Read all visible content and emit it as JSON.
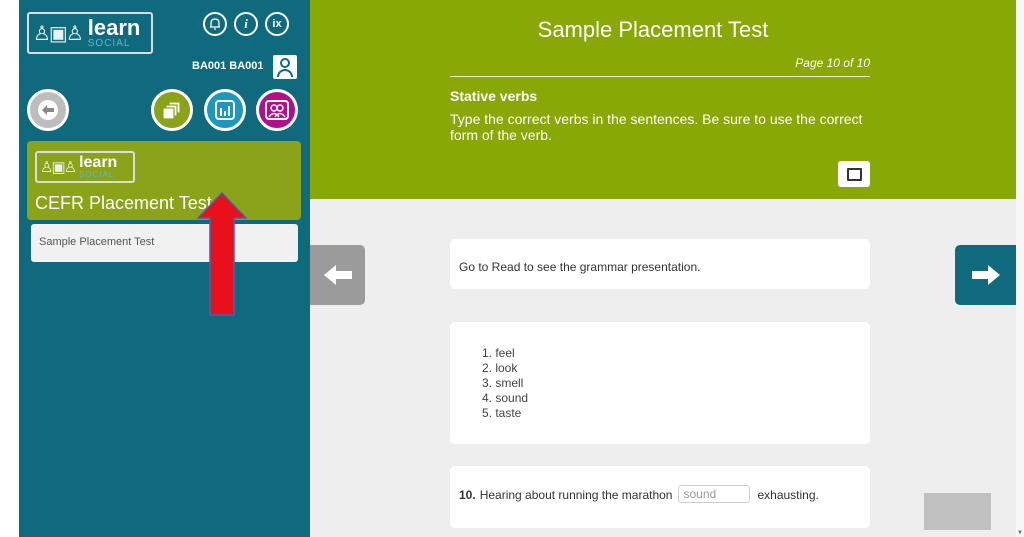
{
  "sidebar": {
    "logo": {
      "marks": "♙▣♙",
      "learn": "learn",
      "social": "SOCIAL"
    },
    "top_icons": [
      {
        "name": "bell-icon",
        "glyph": "♫"
      },
      {
        "name": "info-icon",
        "glyph": "i"
      },
      {
        "name": "accessibility-info-icon",
        "glyph": "ix"
      }
    ],
    "user_id": "BA001 BA001",
    "nav_buttons": {
      "back_glyph": "⬅",
      "courses_glyph": "❐",
      "stats_glyph": "ılı",
      "groups_glyph": "♙♙"
    },
    "course_card": {
      "logo": {
        "marks": "♙▣♙",
        "learn": "learn",
        "social": "SOCIAL"
      },
      "title": "CEFR Placement Test"
    },
    "items": [
      {
        "label": "Sample Placement Test"
      }
    ]
  },
  "header": {
    "title": "Sample Placement Test",
    "page_indicator": "Page 10 of 10",
    "section_title": "Stative verbs",
    "instructions": "Type the correct verbs in the sentences. Be sure to use the correct form of the verb."
  },
  "content": {
    "info_text": "Go to Read to see the grammar presentation.",
    "verb_list": [
      "1. feel",
      "2. look",
      "3. smell",
      "4. sound",
      "5. taste"
    ],
    "question": {
      "number": "10.",
      "before": "Hearing about running the marathon",
      "answer_value": "sound",
      "after": "exhausting."
    }
  },
  "colors": {
    "sidebar": "#0f6a7d",
    "accent_green": "#87a805",
    "annotation_red": "#e8101a",
    "annotation_blue": "#4a5fb0"
  }
}
